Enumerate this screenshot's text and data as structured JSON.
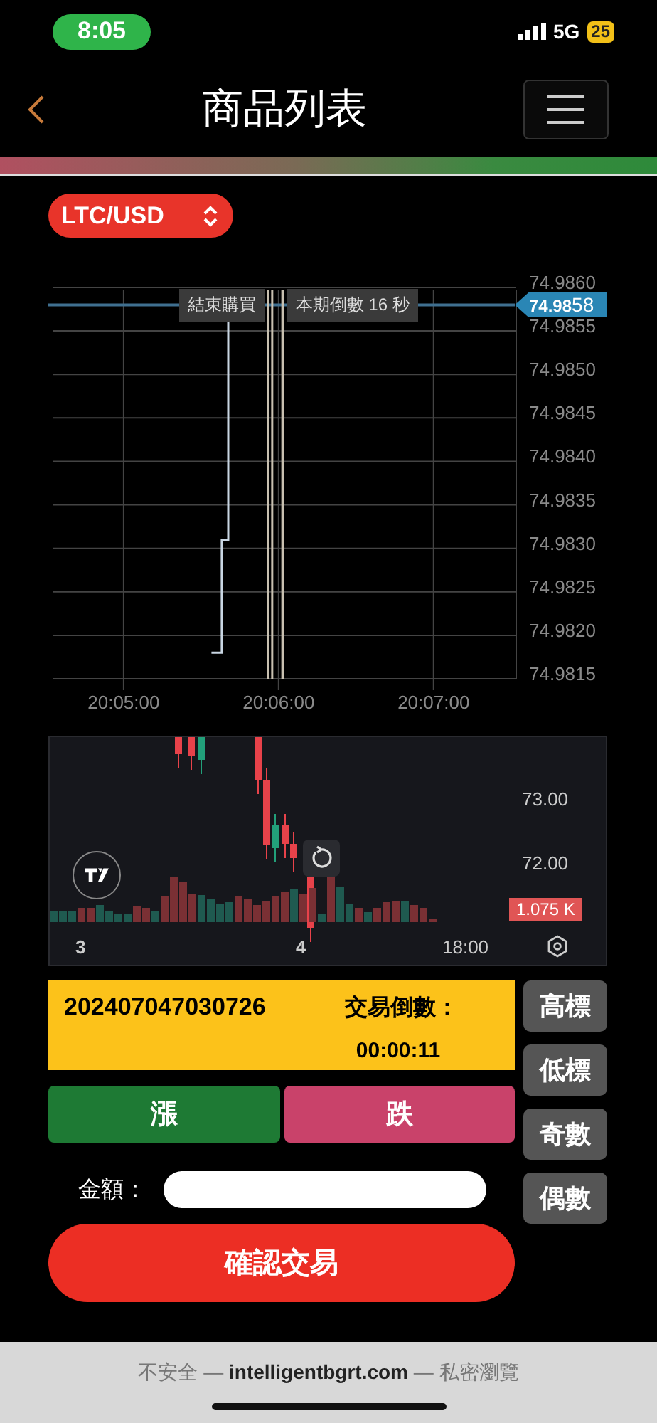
{
  "status_bar": {
    "time": "8:05",
    "network": "5G",
    "battery": "25"
  },
  "header": {
    "title": "商品列表"
  },
  "pair_selector": {
    "value": "LTC/USD"
  },
  "price_chart": {
    "price_axis": [
      "74.9860",
      "74.9855",
      "74.9850",
      "74.9845",
      "74.9840",
      "74.9835",
      "74.9830",
      "74.9825",
      "74.9820",
      "74.9815"
    ],
    "time_axis": [
      "20:05:00",
      "20:06:00",
      "20:07:00"
    ],
    "markers": [
      {
        "label": "結束購買"
      },
      {
        "label": "本期倒數 16 秒"
      }
    ],
    "current_price": "**74.98**58"
  },
  "candle_chart": {
    "price_labels": [
      "73.00",
      "72.00"
    ],
    "volume_label": "1.075 K",
    "time_labels": [
      "3",
      "4",
      "18:00"
    ]
  },
  "order": {
    "id": "202407047030726",
    "countdown_label": "交易倒數：",
    "countdown": "00:00:11"
  },
  "direction_buttons": [
    {
      "label": "漲",
      "kind": "rise"
    },
    {
      "label": "跌",
      "kind": "fall"
    }
  ],
  "side_buttons": [
    "高標",
    "低標",
    "奇數",
    "偶數"
  ],
  "amount": {
    "label": "金額："
  },
  "confirm_button": "確認交易",
  "browser_bar": {
    "address": "不安全 — **intelligentbgrt.com** — 私密瀏覽"
  }
}
